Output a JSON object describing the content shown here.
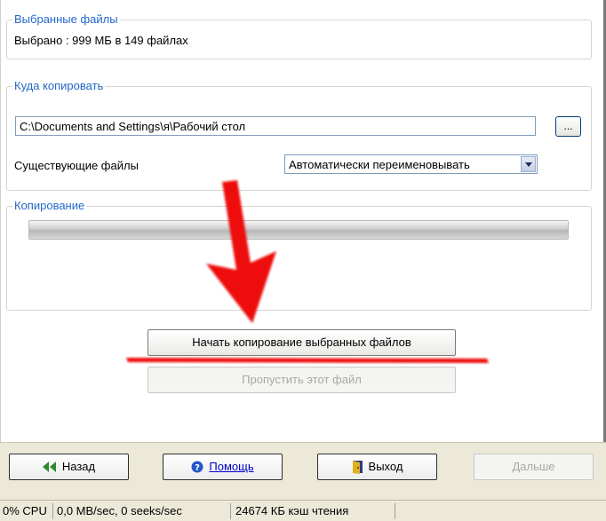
{
  "selected_files": {
    "title": "Выбранные файлы",
    "summary": "Выбрано : 999 МБ в 149 файлах"
  },
  "destination": {
    "title": "Куда копировать",
    "path": "C:\\Documents and Settings\\я\\Рабочий стол",
    "browse_label": "...",
    "existing_label": "Существующие файлы",
    "existing_value": "Автоматически переименовывать"
  },
  "copying": {
    "title": "Копирование",
    "progress": 0.0
  },
  "actions": {
    "start_label": "Начать копирование выбранных файлов",
    "skip_label": "Пропустить этот файл"
  },
  "nav": {
    "back_label": "Назад",
    "help_label": "Помощь",
    "exit_label": "Выход",
    "next_label": "Дальше"
  },
  "status": {
    "cpu": "0% CPU",
    "io": "0,0 MB/sec, 0 seeks/sec",
    "cache": "24674 КБ кэш чтения"
  },
  "colors": {
    "group_title": "#2468c8",
    "annotation": "#ee1111",
    "progress": "#30c030"
  }
}
